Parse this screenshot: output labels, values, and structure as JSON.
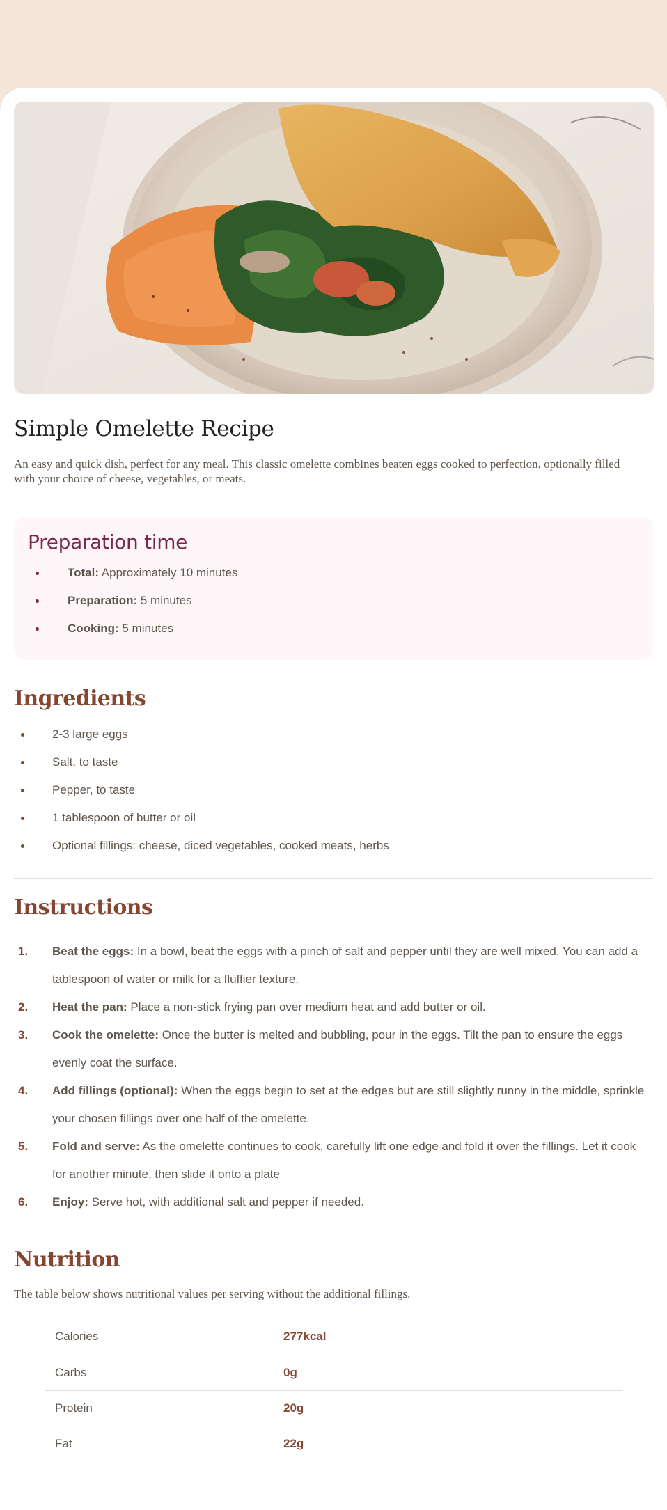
{
  "recipe": {
    "title": "Simple Omelette Recipe",
    "intro": "An easy and quick dish, perfect for any meal. This classic omelette combines beaten eggs cooked to perfection, optionally filled with your choice of cheese, vegetables, or meats.",
    "image": "omelette-photo"
  },
  "preparation": {
    "heading": "Preparation time",
    "items": [
      {
        "label": "Total:",
        "value": " Approximately 10 minutes"
      },
      {
        "label": "Preparation:",
        "value": " 5 minutes"
      },
      {
        "label": "Cooking:",
        "value": " 5 minutes"
      }
    ]
  },
  "ingredients": {
    "heading": "Ingredients",
    "items": [
      "2-3 large eggs",
      "Salt, to taste",
      "Pepper, to taste",
      "1 tablespoon of butter or oil",
      "Optional fillings: cheese, diced vegetables, cooked meats, herbs"
    ]
  },
  "instructions": {
    "heading": "Instructions",
    "steps": [
      {
        "num": "1.",
        "label": "Beat the eggs:",
        "text": " In a bowl, beat the eggs with a pinch of salt and pepper until they are well mixed. You can add a tablespoon of water or milk for a fluffier texture."
      },
      {
        "num": "2.",
        "label": "Heat the pan:",
        "text": " Place a non-stick frying pan over medium heat and add butter or oil."
      },
      {
        "num": "3.",
        "label": "Cook the omelette:",
        "text": " Once the butter is melted and bubbling, pour in the eggs. Tilt the pan to ensure the eggs evenly coat the surface."
      },
      {
        "num": "4.",
        "label": "Add fillings (optional):",
        "text": " When the eggs begin to set at the edges but are still slightly runny in the middle, sprinkle your chosen fillings over one half of the omelette."
      },
      {
        "num": "5.",
        "label": "Fold and serve:",
        "text": " As the omelette continues to cook, carefully lift one edge and fold it over the fillings. Let it cook for another minute, then slide it onto a plate"
      },
      {
        "num": "6.",
        "label": "Enjoy:",
        "text": " Serve hot, with additional salt and pepper if needed."
      }
    ]
  },
  "nutrition": {
    "heading": "Nutrition",
    "description": "The table below shows nutritional values per serving without the additional fillings.",
    "rows": [
      {
        "label": "Calories",
        "value": "277kcal"
      },
      {
        "label": "Carbs",
        "value": "0g"
      },
      {
        "label": "Protein",
        "value": "20g"
      },
      {
        "label": "Fat",
        "value": "22g"
      }
    ]
  },
  "colors": {
    "page_background": "#f3e5d9",
    "card_background": "#ffffff",
    "prep_background": "#fff6fa",
    "prep_accent": "#7a284b",
    "heading_accent": "#854632",
    "body_text": "#5f564d",
    "title_text": "#24211e"
  }
}
